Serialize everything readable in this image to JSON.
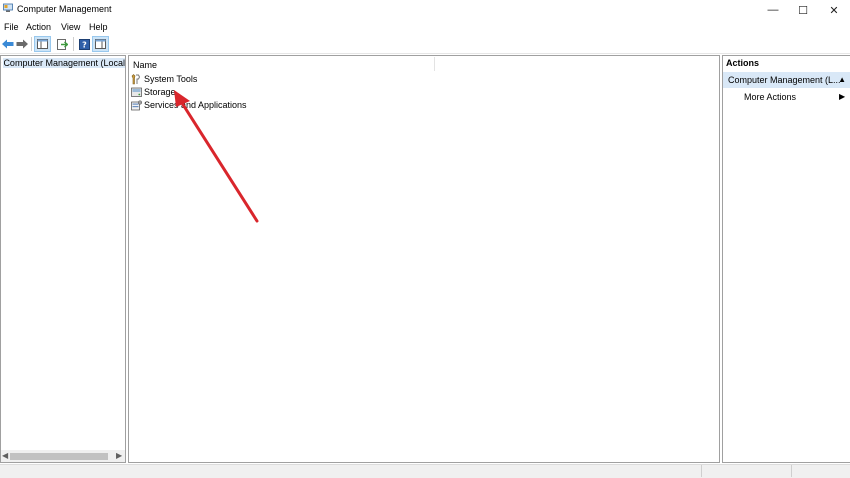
{
  "window": {
    "title": "Computer Management",
    "minimize_glyph": "—",
    "maximize_glyph": "☐",
    "close_glyph": "✕"
  },
  "menu": {
    "items": [
      {
        "label": "File"
      },
      {
        "label": "Action"
      },
      {
        "label": "View"
      },
      {
        "label": "Help"
      }
    ]
  },
  "toolbar": {
    "buttons": [
      "back-icon",
      "forward-icon",
      "show-hide-tree-icon",
      "export-list-icon",
      "help-icon",
      "show-hide-action-pane-icon"
    ]
  },
  "tree": {
    "root_label": "Computer Management (Local"
  },
  "list": {
    "column_name": "Name",
    "rows": [
      {
        "label": "System Tools",
        "icon": "system-tools-icon"
      },
      {
        "label": "Storage",
        "icon": "storage-icon"
      },
      {
        "label": "Services and Applications",
        "icon": "services-applications-icon"
      }
    ]
  },
  "actions": {
    "title": "Actions",
    "group_label": "Computer Management (L...",
    "more_actions": "More Actions"
  },
  "annotation": {
    "arrow_color": "#d9262c"
  },
  "colors": {
    "selection": "#d9e8f7",
    "pane_border": "#a0a0a0"
  }
}
